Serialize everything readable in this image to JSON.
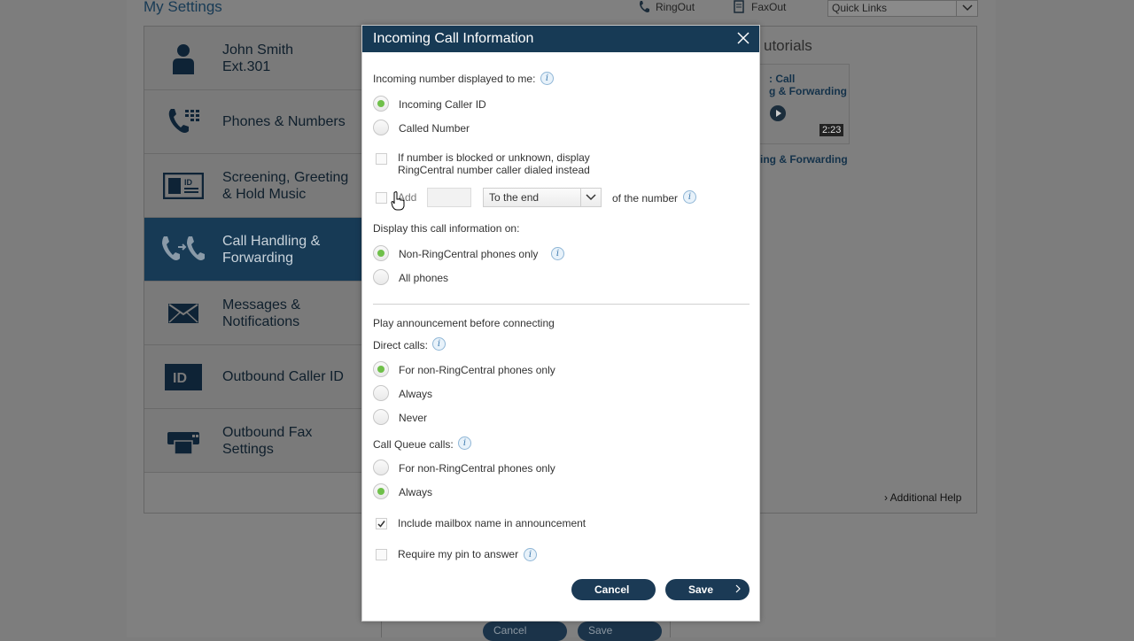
{
  "page": {
    "title": "My Settings",
    "top_links": {
      "ringout": "RingOut",
      "faxout": "FaxOut",
      "quick_links": "Quick Links"
    },
    "sidebar": [
      {
        "label_1": "John Smith",
        "label_2": "Ext.301",
        "icon": "user-icon"
      },
      {
        "label_1": "Phones & Numbers",
        "label_2": "",
        "icon": "phone-keypad-icon"
      },
      {
        "label_1": "Screening, Greeting",
        "label_2": "& Hold Music",
        "icon": "id-card-icon"
      },
      {
        "label_1": "Call Handling &",
        "label_2": "Forwarding",
        "icon": "call-forward-icon"
      },
      {
        "label_1": "Messages &",
        "label_2": "Notifications",
        "icon": "envelope-icon"
      },
      {
        "label_1": "Outbound Caller ID",
        "label_2": "",
        "icon": "id-badge-icon"
      },
      {
        "label_1": "Outbound Fax",
        "label_2": "Settings",
        "icon": "fax-icon"
      }
    ],
    "tutorials": {
      "title": "utorials",
      "thumb_line1": ": Call",
      "thumb_line2": "g & Forwarding",
      "duration": "2:23",
      "caption": "ing & Forwarding"
    },
    "additional_help": "Additional Help",
    "bottom_cancel": "Cancel",
    "bottom_save": "Save"
  },
  "modal": {
    "title": "Incoming Call Information",
    "incoming_label": "Incoming number displayed to me:",
    "opt_caller_id": "Incoming Caller ID",
    "opt_called_number": "Called Number",
    "blocked_line1": "If number is blocked or unknown, display",
    "blocked_line2": "RingCentral number caller dialed instead",
    "add_label": "Add",
    "add_value": "",
    "position_select": "To the end",
    "of_number": "of the number",
    "display_on_label": "Display this call information on:",
    "opt_non_rc": "Non-RingCentral phones only",
    "opt_all_phones": "All phones",
    "announcement_label": "Play announcement before connecting",
    "direct_calls_label": "Direct calls:",
    "direct_opt1": "For non-RingCentral phones only",
    "direct_opt2": "Always",
    "direct_opt3": "Never",
    "queue_label": "Call Queue calls:",
    "queue_opt1": "For non-RingCentral phones only",
    "queue_opt2": "Always",
    "include_mailbox": "Include mailbox name in announcement",
    "require_pin": "Require my pin to answer",
    "cancel": "Cancel",
    "save": "Save"
  }
}
